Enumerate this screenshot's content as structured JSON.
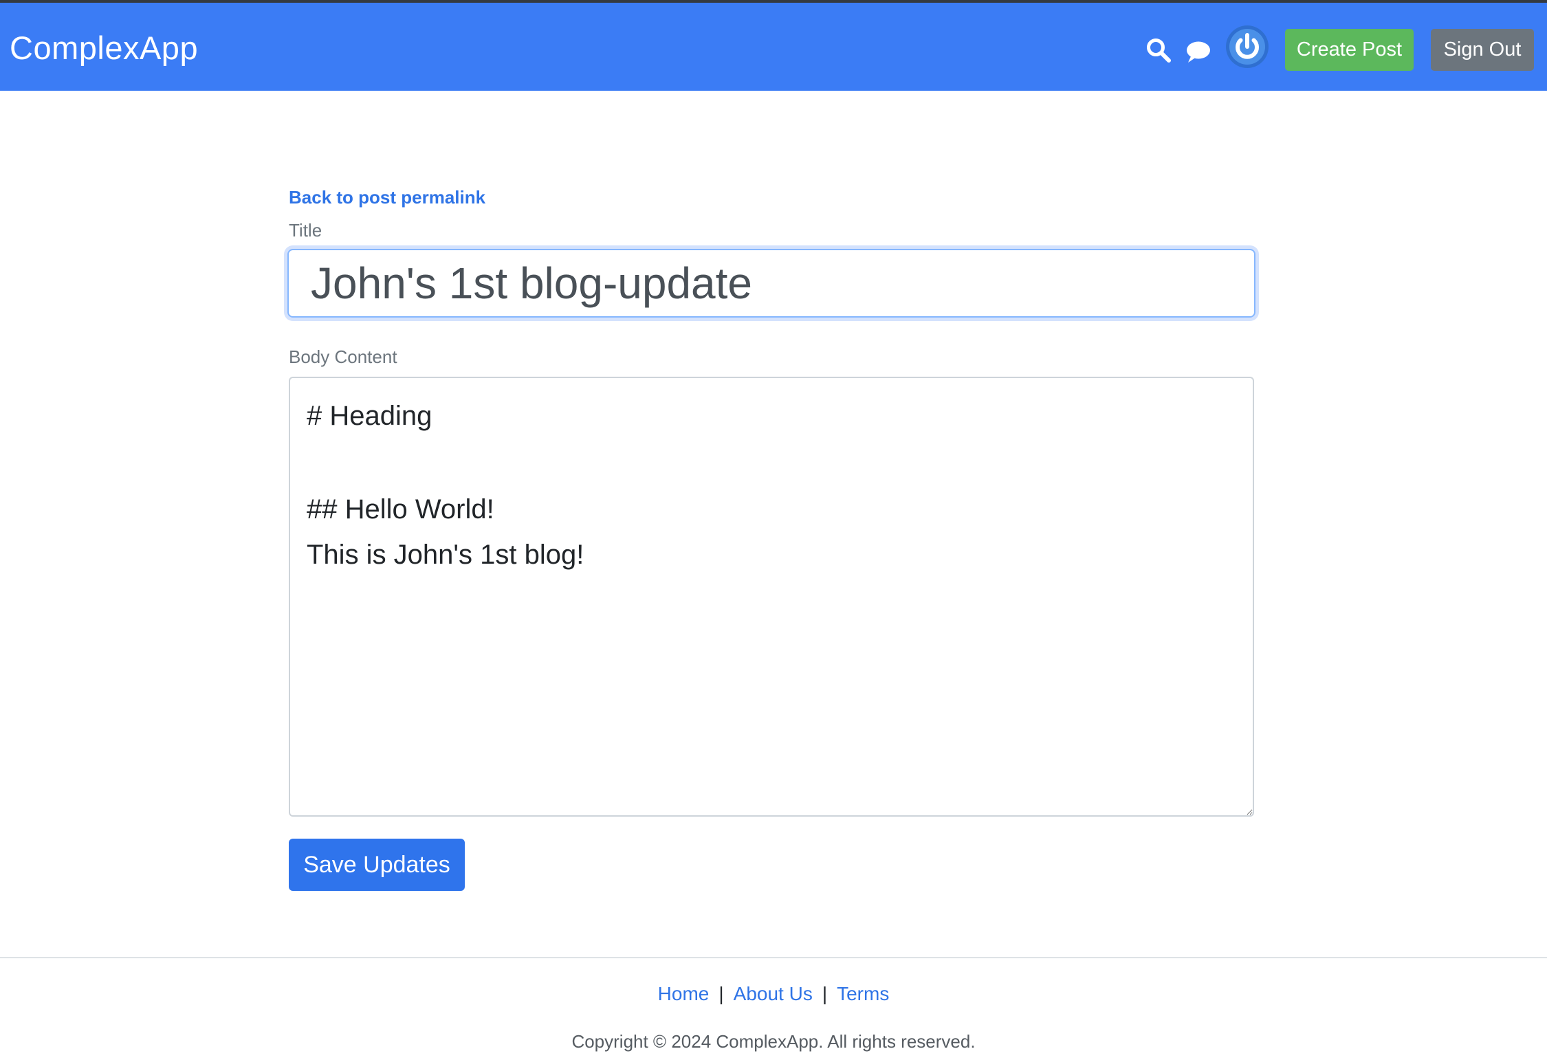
{
  "header": {
    "brand": "ComplexApp",
    "create_post_label": "Create Post",
    "sign_out_label": "Sign Out",
    "icons": [
      "search-icon",
      "chat-icon",
      "avatar"
    ],
    "bg_color": "#3b7cf5"
  },
  "form": {
    "back_link": "Back to post permalink",
    "title_label": "Title",
    "title_value": "John's 1st blog-update",
    "body_label": "Body Content",
    "body_lines": [
      "# Heading",
      "## Hello World!",
      "This is John's 1st blog!"
    ],
    "save_label": "Save Updates"
  },
  "footer": {
    "links": [
      "Home",
      "About Us",
      "Terms"
    ],
    "separator": "|",
    "copyright": "Copyright © 2024 ComplexApp. All rights reserved."
  }
}
